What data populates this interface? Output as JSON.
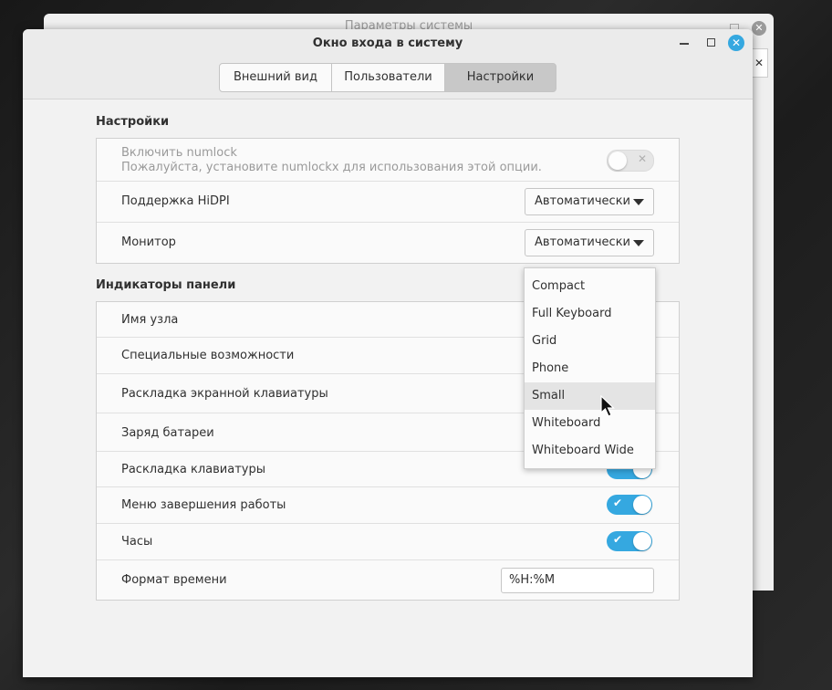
{
  "back_window": {
    "title": "Параметры системы",
    "close_glyph": "✕",
    "x_glyph": "✕"
  },
  "window": {
    "title": "Окно входа в систему",
    "close_glyph": "✕",
    "accent": "#35a8e0"
  },
  "tabs": [
    {
      "label": "Внешний вид",
      "active": false
    },
    {
      "label": "Пользователи",
      "active": false
    },
    {
      "label": "Настройки",
      "active": true
    }
  ],
  "settings": {
    "title": "Настройки",
    "numlock": {
      "label": "Включить numlock",
      "note": "Пожалуйста, установите numlockx для использования этой опции.",
      "state": "off",
      "disabled": true,
      "off_glyph": "✕"
    },
    "hidpi": {
      "label": "Поддержка HiDPI",
      "value": "Автоматически"
    },
    "monitor": {
      "label": "Монитор",
      "value": "Автоматически"
    }
  },
  "indicators": {
    "title": "Индикаторы панели",
    "rows": [
      {
        "label": "Имя узла"
      },
      {
        "label": "Специальные возможности"
      },
      {
        "label": "Раскладка экранной клавиатуры"
      },
      {
        "label": "Заряд батареи"
      },
      {
        "label": "Раскладка клавиатуры",
        "state": "on"
      },
      {
        "label": "Меню завершения работы",
        "state": "on"
      },
      {
        "label": "Часы",
        "state": "on"
      }
    ],
    "time_format": {
      "label": "Формат времени",
      "value": "%H:%M"
    },
    "on_glyph": "✔"
  },
  "dropdown": {
    "options": [
      "Compact",
      "Full Keyboard",
      "Grid",
      "Phone",
      "Small",
      "Whiteboard",
      "Whiteboard Wide"
    ],
    "highlighted": "Small"
  }
}
